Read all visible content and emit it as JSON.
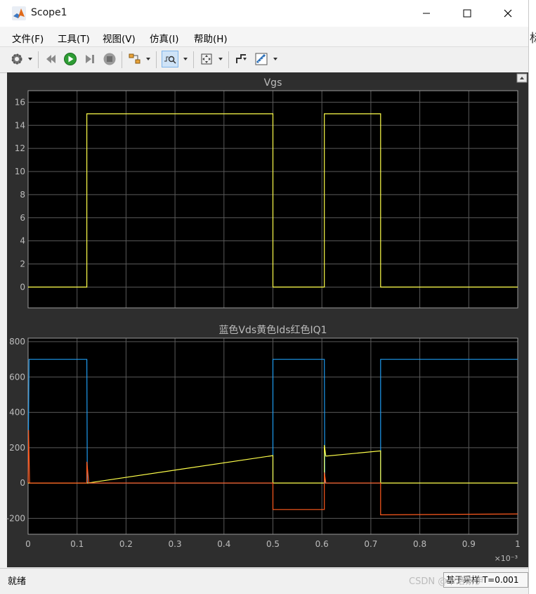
{
  "window": {
    "title": "Scope1",
    "icon": "matlab-icon"
  },
  "menu": [
    {
      "label": "文件(F)"
    },
    {
      "label": "工具(T)"
    },
    {
      "label": "视图(V)"
    },
    {
      "label": "仿真(I)"
    },
    {
      "label": "帮助(H)"
    }
  ],
  "menu_extra_glyph": "↘",
  "background_sliver_glyph": "标",
  "toolbar": [
    "settings-icon",
    "step-back-icon",
    "run-icon",
    "step-forward-icon",
    "stop-icon",
    "highlight-block-icon",
    "trigger-icon",
    "zoom-fit-icon",
    "style-icon",
    "measurement-icon"
  ],
  "status": {
    "left": "就绪",
    "right": "基于采样  T=0.001"
  },
  "watermark": "CSDN @卡洛斯伊",
  "colors": {
    "plot_bg": "#000000",
    "frame_bg": "#2e2e2e",
    "grid": "#5a5a5a",
    "text": "#bcbcbc",
    "yellow": "#ffff4a",
    "blue": "#1e9bf0",
    "red": "#ff5a1e"
  },
  "chart_data": [
    {
      "type": "line",
      "title": "Vgs",
      "xlim": [
        0,
        0.001
      ],
      "ylim": [
        -1.8,
        17
      ],
      "xticks": [
        0,
        0.0001,
        0.0002,
        0.0003,
        0.0004,
        0.0005,
        0.0006,
        0.0007,
        0.0008,
        0.0009,
        0.001
      ],
      "yticks": [
        0,
        2,
        4,
        6,
        8,
        10,
        12,
        14,
        16
      ],
      "ytick_labels": [
        "0",
        "2",
        "4",
        "6",
        "8",
        "10",
        "12",
        "14",
        "16"
      ],
      "grid": true,
      "series": [
        {
          "color": "#ffff4a",
          "x": [
            0,
            0.00012,
            0.00012,
            0.0005,
            0.0005,
            0.000605,
            0.000605,
            0.00072,
            0.00072,
            0.001
          ],
          "y": [
            0,
            0,
            15,
            15,
            0,
            0,
            15,
            15,
            0,
            0
          ]
        }
      ]
    },
    {
      "type": "line",
      "title": "蓝色Vds黄色Ids红色IQ1",
      "xlim": [
        0,
        0.001
      ],
      "ylim": [
        -290,
        820
      ],
      "xticks": [
        0,
        0.0001,
        0.0002,
        0.0003,
        0.0004,
        0.0005,
        0.0006,
        0.0007,
        0.0008,
        0.0009,
        0.001
      ],
      "xtick_labels": [
        "0",
        "0.1",
        "0.2",
        "0.3",
        "0.4",
        "0.5",
        "0.6",
        "0.7",
        "0.8",
        "0.9",
        "1"
      ],
      "x_exponent": "×10⁻³",
      "yticks": [
        -200,
        0,
        200,
        400,
        600,
        800
      ],
      "ytick_labels": [
        "-200",
        "0",
        "200",
        "400",
        "600",
        "800"
      ],
      "grid": true,
      "series": [
        {
          "color": "#1e9bf0",
          "x": [
            0,
            2e-06,
            0.00012,
            0.000121,
            0.0005,
            0.0005,
            0.000605,
            0.000606,
            0.00072,
            0.00072,
            0.001
          ],
          "y": [
            0,
            700,
            700,
            0,
            0,
            700,
            700,
            0,
            0,
            700,
            700
          ]
        },
        {
          "color": "#ffff4a",
          "x": [
            0,
            0.00012,
            0.000122,
            0.0005,
            0.0005,
            0.000605,
            0.000605,
            0.000608,
            0.00072,
            0.00072,
            0.001
          ],
          "y": [
            0,
            0,
            0,
            155,
            0,
            0,
            215,
            152,
            182,
            0,
            0
          ]
        },
        {
          "color": "#ff5a1e",
          "x": [
            0,
            1e-06,
            3e-06,
            0.00012,
            0.00012,
            0.000124,
            0.0005,
            0.0005,
            0.000605,
            0.000605,
            0.000608,
            0.00072,
            0.00072,
            0.001
          ],
          "y": [
            0,
            300,
            0,
            0,
            120,
            0,
            0,
            -150,
            -150,
            60,
            0,
            0,
            -180,
            -175
          ]
        }
      ]
    }
  ]
}
